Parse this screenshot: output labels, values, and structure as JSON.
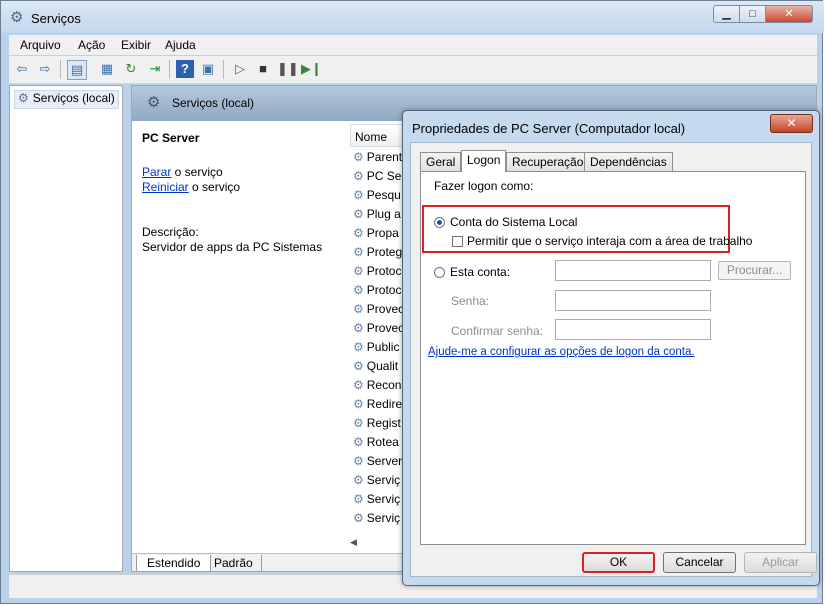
{
  "window": {
    "title": "Serviços"
  },
  "menu": [
    "Arquivo",
    "Ação",
    "Exibir",
    "Ajuda"
  ],
  "tree": {
    "item": "Serviços (local)"
  },
  "content": {
    "header": "Serviços (local)",
    "service_name": "PC Server",
    "action_stop_link": "Parar",
    "action_stop_rest": " o serviço",
    "action_restart_link": "Reiniciar",
    "action_restart_rest": " o serviço",
    "description_label": "Descrição:",
    "description": "Servidor de apps da PC Sistemas",
    "column_name": "Nome",
    "services": [
      "Parent",
      "PC Ser",
      "Pesqu",
      "Plug a",
      "Propa",
      "Proteg",
      "Protoc",
      "Protoc",
      "Provec",
      "Provec",
      "Public",
      "Qualit",
      "Recon",
      "Redire",
      "Regist",
      "Rotea",
      "Server",
      "Serviç",
      "Serviç",
      "Serviç"
    ],
    "tabs": [
      "Estendido",
      "Padrão"
    ]
  },
  "dialog": {
    "title": "Propriedades de PC Server (Computador local)",
    "close_glyph": "✕",
    "tabs": [
      "Geral",
      "Logon",
      "Recuperação",
      "Dependências"
    ],
    "active_tab": "Logon",
    "logon_as_label": "Fazer logon como:",
    "local_system_label": "Conta do Sistema Local",
    "local_system_selected": true,
    "interact_label": "Permitir que o serviço interaja com a área de trabalho",
    "interact_checked": false,
    "this_account_label": "Esta conta:",
    "account_value": "",
    "browse_button": "Procurar...",
    "password_label": "Senha:",
    "password_value": "",
    "confirm_label": "Confirmar senha:",
    "confirm_value": "",
    "help_link": "Ajude-me a configurar as opções de logon da conta.",
    "ok_button": "OK",
    "cancel_button": "Cancelar",
    "apply_button": "Aplicar"
  },
  "colors": {
    "highlight": "#e02020",
    "link": "#0033cc",
    "header": "#9fb5cc"
  }
}
